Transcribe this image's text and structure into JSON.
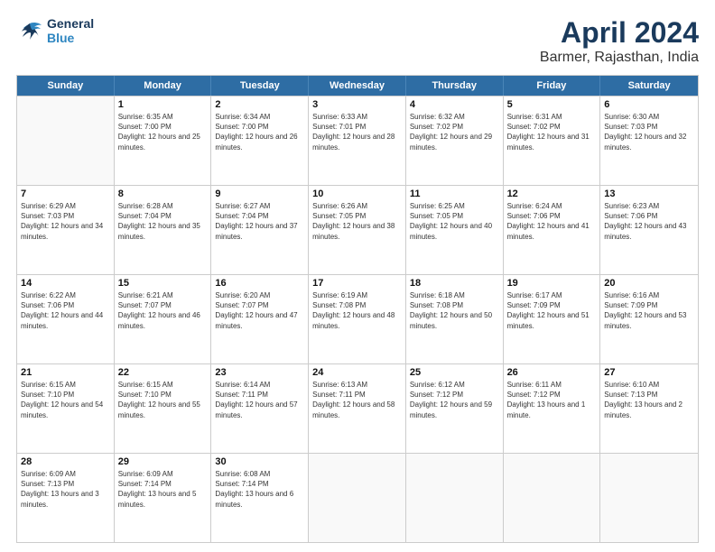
{
  "logo": {
    "line1": "General",
    "line2": "Blue"
  },
  "title": "April 2024",
  "location": "Barmer, Rajasthan, India",
  "days_of_week": [
    "Sunday",
    "Monday",
    "Tuesday",
    "Wednesday",
    "Thursday",
    "Friday",
    "Saturday"
  ],
  "weeks": [
    [
      {
        "day": null
      },
      {
        "day": "1",
        "sunrise": "6:35 AM",
        "sunset": "7:00 PM",
        "daylight": "12 hours and 25 minutes."
      },
      {
        "day": "2",
        "sunrise": "6:34 AM",
        "sunset": "7:00 PM",
        "daylight": "12 hours and 26 minutes."
      },
      {
        "day": "3",
        "sunrise": "6:33 AM",
        "sunset": "7:01 PM",
        "daylight": "12 hours and 28 minutes."
      },
      {
        "day": "4",
        "sunrise": "6:32 AM",
        "sunset": "7:02 PM",
        "daylight": "12 hours and 29 minutes."
      },
      {
        "day": "5",
        "sunrise": "6:31 AM",
        "sunset": "7:02 PM",
        "daylight": "12 hours and 31 minutes."
      },
      {
        "day": "6",
        "sunrise": "6:30 AM",
        "sunset": "7:03 PM",
        "daylight": "12 hours and 32 minutes."
      }
    ],
    [
      {
        "day": "7",
        "sunrise": "6:29 AM",
        "sunset": "7:03 PM",
        "daylight": "12 hours and 34 minutes."
      },
      {
        "day": "8",
        "sunrise": "6:28 AM",
        "sunset": "7:04 PM",
        "daylight": "12 hours and 35 minutes."
      },
      {
        "day": "9",
        "sunrise": "6:27 AM",
        "sunset": "7:04 PM",
        "daylight": "12 hours and 37 minutes."
      },
      {
        "day": "10",
        "sunrise": "6:26 AM",
        "sunset": "7:05 PM",
        "daylight": "12 hours and 38 minutes."
      },
      {
        "day": "11",
        "sunrise": "6:25 AM",
        "sunset": "7:05 PM",
        "daylight": "12 hours and 40 minutes."
      },
      {
        "day": "12",
        "sunrise": "6:24 AM",
        "sunset": "7:06 PM",
        "daylight": "12 hours and 41 minutes."
      },
      {
        "day": "13",
        "sunrise": "6:23 AM",
        "sunset": "7:06 PM",
        "daylight": "12 hours and 43 minutes."
      }
    ],
    [
      {
        "day": "14",
        "sunrise": "6:22 AM",
        "sunset": "7:06 PM",
        "daylight": "12 hours and 44 minutes."
      },
      {
        "day": "15",
        "sunrise": "6:21 AM",
        "sunset": "7:07 PM",
        "daylight": "12 hours and 46 minutes."
      },
      {
        "day": "16",
        "sunrise": "6:20 AM",
        "sunset": "7:07 PM",
        "daylight": "12 hours and 47 minutes."
      },
      {
        "day": "17",
        "sunrise": "6:19 AM",
        "sunset": "7:08 PM",
        "daylight": "12 hours and 48 minutes."
      },
      {
        "day": "18",
        "sunrise": "6:18 AM",
        "sunset": "7:08 PM",
        "daylight": "12 hours and 50 minutes."
      },
      {
        "day": "19",
        "sunrise": "6:17 AM",
        "sunset": "7:09 PM",
        "daylight": "12 hours and 51 minutes."
      },
      {
        "day": "20",
        "sunrise": "6:16 AM",
        "sunset": "7:09 PM",
        "daylight": "12 hours and 53 minutes."
      }
    ],
    [
      {
        "day": "21",
        "sunrise": "6:15 AM",
        "sunset": "7:10 PM",
        "daylight": "12 hours and 54 minutes."
      },
      {
        "day": "22",
        "sunrise": "6:15 AM",
        "sunset": "7:10 PM",
        "daylight": "12 hours and 55 minutes."
      },
      {
        "day": "23",
        "sunrise": "6:14 AM",
        "sunset": "7:11 PM",
        "daylight": "12 hours and 57 minutes."
      },
      {
        "day": "24",
        "sunrise": "6:13 AM",
        "sunset": "7:11 PM",
        "daylight": "12 hours and 58 minutes."
      },
      {
        "day": "25",
        "sunrise": "6:12 AM",
        "sunset": "7:12 PM",
        "daylight": "12 hours and 59 minutes."
      },
      {
        "day": "26",
        "sunrise": "6:11 AM",
        "sunset": "7:12 PM",
        "daylight": "13 hours and 1 minute."
      },
      {
        "day": "27",
        "sunrise": "6:10 AM",
        "sunset": "7:13 PM",
        "daylight": "13 hours and 2 minutes."
      }
    ],
    [
      {
        "day": "28",
        "sunrise": "6:09 AM",
        "sunset": "7:13 PM",
        "daylight": "13 hours and 3 minutes."
      },
      {
        "day": "29",
        "sunrise": "6:09 AM",
        "sunset": "7:14 PM",
        "daylight": "13 hours and 5 minutes."
      },
      {
        "day": "30",
        "sunrise": "6:08 AM",
        "sunset": "7:14 PM",
        "daylight": "13 hours and 6 minutes."
      },
      {
        "day": null
      },
      {
        "day": null
      },
      {
        "day": null
      },
      {
        "day": null
      }
    ]
  ]
}
